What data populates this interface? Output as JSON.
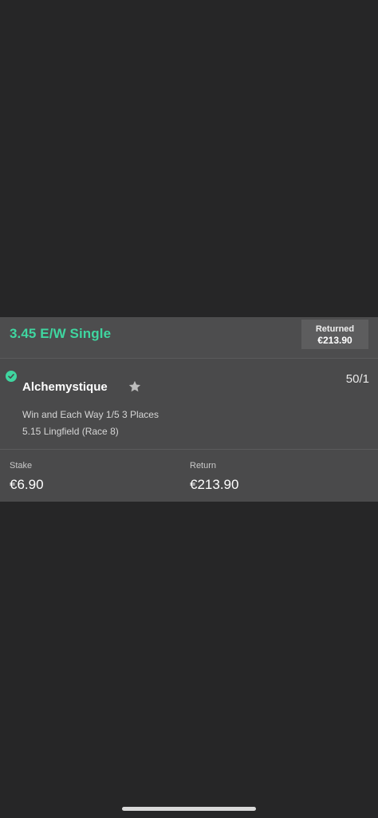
{
  "bet": {
    "title": "3.45 E/W Single",
    "returned_label": "Returned",
    "returned_amount": "€213.90"
  },
  "selection": {
    "name": "Alchemystique",
    "odds": "50/1",
    "market": "Win and Each Way 1/5 3 Places",
    "event": "5.15 Lingfield (Race 8)",
    "status_icon": "check-circle-icon",
    "favourite_icon": "star-icon"
  },
  "footer": {
    "stake_label": "Stake",
    "stake_value": "€6.90",
    "return_label": "Return",
    "return_value": "€213.90"
  },
  "colors": {
    "background": "#262627",
    "card": "#4a4a4b",
    "accent": "#3fd6a0"
  }
}
